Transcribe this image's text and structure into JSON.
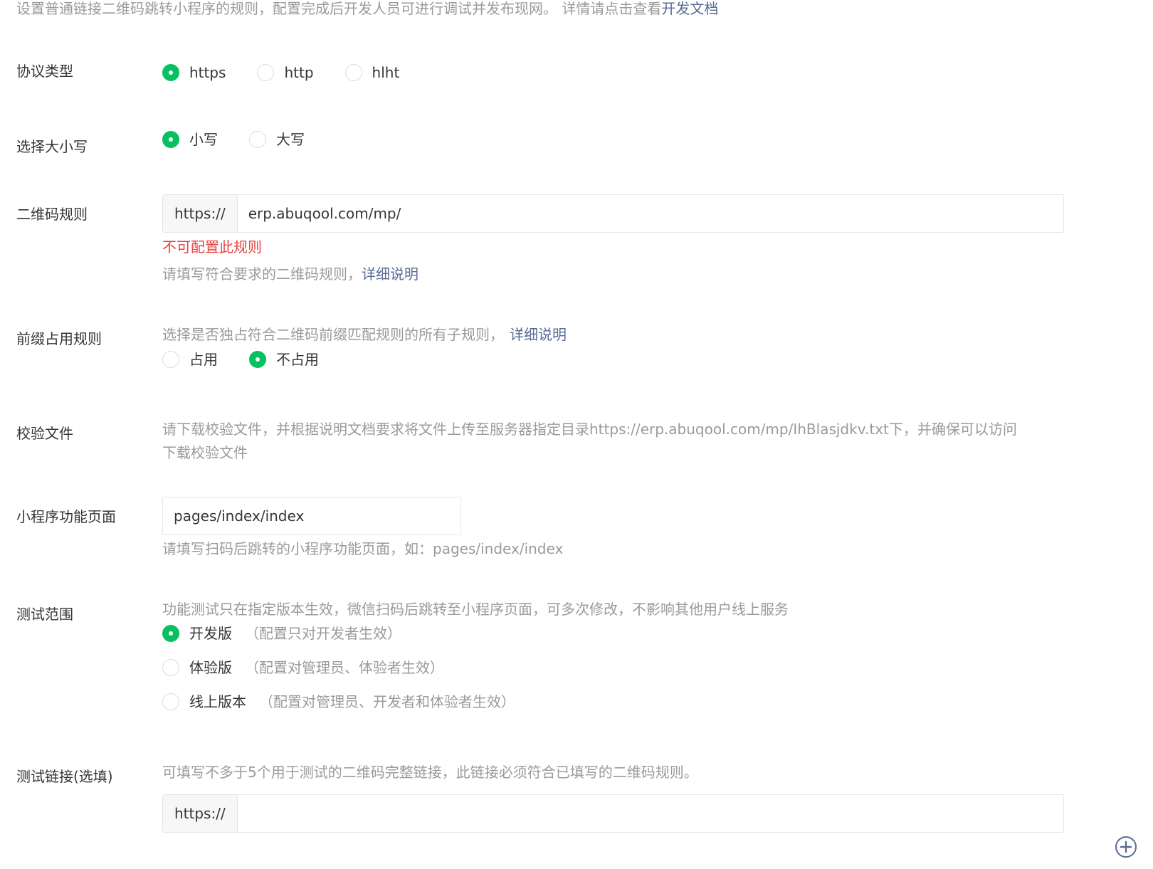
{
  "intro": {
    "text": "设置普通链接二维码跳转小程序的规则，配置完成后开发人员可进行调试并发布现网。 详情请点击查看",
    "link": "开发文档"
  },
  "protocol": {
    "label": "协议类型",
    "options": [
      "https",
      "http",
      "hlht"
    ],
    "selected": "https"
  },
  "case": {
    "label": "选择大小写",
    "options": [
      "小写",
      "大写"
    ],
    "selected": "小写"
  },
  "qr_rule": {
    "label": "二维码规则",
    "prefix": "https://",
    "value": "erp.abuqool.com/mp/",
    "error": "不可配置此规则",
    "hint": "请填写符合要求的二维码规则，",
    "hint_link": "详细说明"
  },
  "prefix_rule": {
    "label": "前缀占用规则",
    "hint": "选择是否独占符合二维码前缀匹配规则的所有子规则，",
    "hint_link": "详细说明",
    "options": [
      "占用",
      "不占用"
    ],
    "selected": "不占用"
  },
  "verify_file": {
    "label": "校验文件",
    "hint": "请下载校验文件，并根据说明文档要求将文件上传至服务器指定目录https://erp.abuqool.com/mp/IhBlasjdkv.txt下，并确保可以访问",
    "download_link": "下载校验文件"
  },
  "page": {
    "label": "小程序功能页面",
    "value": "pages/index/index",
    "hint": "请填写扫码后跳转的小程序功能页面，如：pages/index/index"
  },
  "test_scope": {
    "label": "测试范围",
    "hint": "功能测试只在指定版本生效，微信扫码后跳转至小程序页面，可多次修改，不影响其他用户线上服务",
    "options": [
      {
        "label": "开发版",
        "note": "（配置只对开发者生效）"
      },
      {
        "label": "体验版",
        "note": "（配置对管理员、体验者生效）"
      },
      {
        "label": "线上版本",
        "note": "（配置对管理员、开发者和体验者生效）"
      }
    ],
    "selected": "开发版"
  },
  "test_links": {
    "label": "测试链接(选填)",
    "hint": "可填写不多于5个用于测试的二维码完整链接，此链接必须符合已填写的二维码规则。",
    "prefix": "https://",
    "value": "",
    "add_icon": "plus-circle-icon"
  }
}
